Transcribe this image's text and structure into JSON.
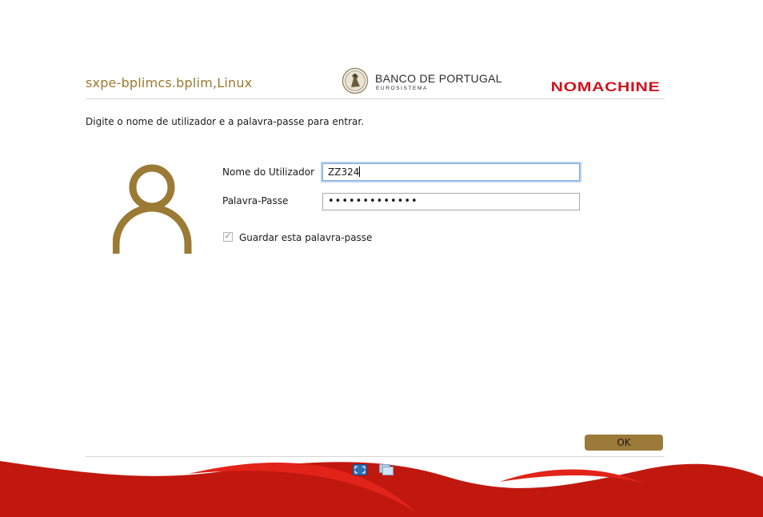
{
  "header": {
    "host_title": "sxpe-bplimcs.bplim,Linux",
    "bank_name": "BANCO DE PORTUGAL",
    "bank_subtitle": "EUROSISTEMA",
    "brand_logo": "NOMACHINE"
  },
  "login": {
    "instruction": "Digite o nome de utilizador e a palavra-passe para entrar.",
    "username_label": "Nome do Utilizador",
    "username_value": "ZZ324",
    "password_label": "Palavra-Passe",
    "password_masked": "•••••••••••••",
    "remember_label": "Guardar esta palavra-passe",
    "remember_checked": true
  },
  "footer": {
    "ok_label": "OK",
    "toolbar_icons": [
      "fullscreen-icon",
      "window-switch-icon"
    ]
  },
  "colors": {
    "accent_gold": "#9b7a2e",
    "brand_red": "#d0131f",
    "wave_red": "#c0180e",
    "focus_blue": "#7fa7d9"
  }
}
